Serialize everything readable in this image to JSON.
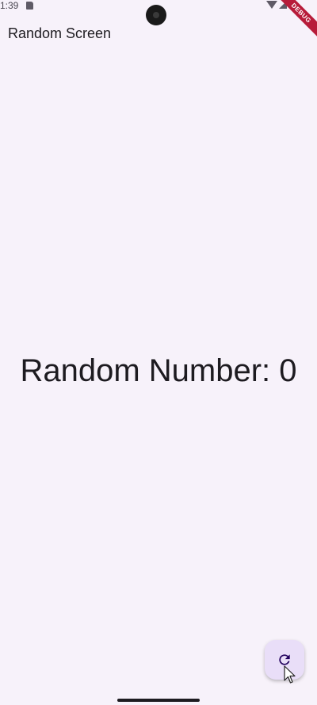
{
  "status_bar": {
    "time": "1:39",
    "debug_label": "DEBUG",
    "icons": [
      "sim-card-icon",
      "wifi-icon",
      "signal-icon",
      "camera-cutout"
    ]
  },
  "app_bar": {
    "title": "Random Screen"
  },
  "main": {
    "random_text": "Random Number: 0"
  },
  "fab": {
    "icon": "refresh-icon"
  },
  "colors": {
    "background": "#f7f2fa",
    "fab": "#e9def8",
    "debug_banner": "#b71c3a",
    "text": "#1d1b20"
  }
}
